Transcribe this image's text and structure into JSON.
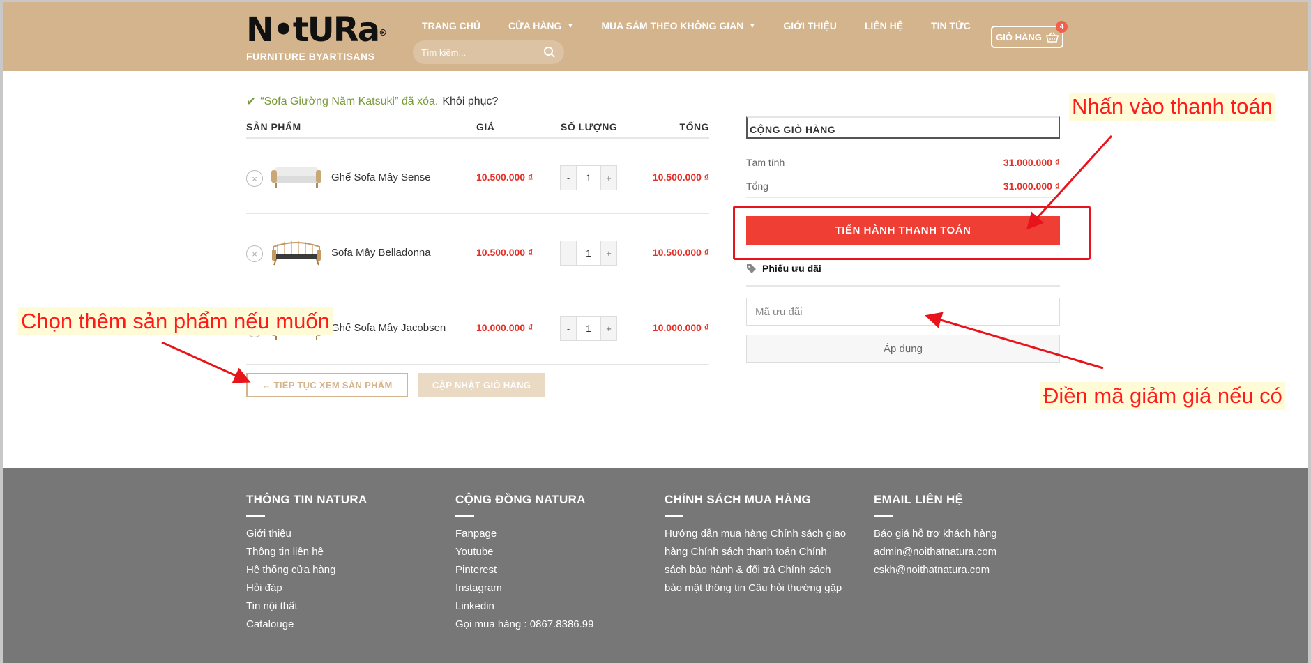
{
  "header": {
    "logo_wordmark": "N•tURa",
    "logo_reg": "®",
    "logo_tagline": "FURNITURE BYARTISANS",
    "nav": [
      {
        "label": "TRANG CHỦ",
        "dropdown": false
      },
      {
        "label": "CỬA HÀNG",
        "dropdown": true
      },
      {
        "label": "MUA SẮM THEO KHÔNG GIAN",
        "dropdown": true
      },
      {
        "label": "GIỚI THIỆU",
        "dropdown": false
      },
      {
        "label": "LIÊN HỆ",
        "dropdown": false
      },
      {
        "label": "TIN TỨC",
        "dropdown": false
      }
    ],
    "search_placeholder": "Tìm kiếm...",
    "cart_label": "GIỎ HÀNG",
    "cart_count": "4"
  },
  "notice": {
    "message": "“Sofa Giường Năm Katsuki” đã xóa.",
    "undo": "Khôi phục?"
  },
  "cart": {
    "headers": {
      "product": "SẢN PHẨM",
      "price": "GIÁ",
      "quantity": "SỐ LƯỢNG",
      "total": "TỔNG"
    },
    "items": [
      {
        "name": "Ghế Sofa Mây Sense",
        "price": "10.500.000 ₫",
        "qty": "1",
        "total": "10.500.000 ₫"
      },
      {
        "name": "Sofa Mây Belladonna",
        "price": "10.500.000 ₫",
        "qty": "1",
        "total": "10.500.000 ₫"
      },
      {
        "name": "Ghế Sofa Mây Jacobsen",
        "price": "10.000.000 ₫",
        "qty": "1",
        "total": "10.000.000 ₫"
      }
    ],
    "minus": "-",
    "plus": "+",
    "remove": "×",
    "continue_label": "← TIẾP TỤC XEM SẢN PHẨM",
    "update_label": "CẬP NHẬT GIỎ HÀNG"
  },
  "totals": {
    "title": "CỘNG GIỎ HÀNG",
    "subtotal_label": "Tạm tính",
    "subtotal_value": "31.000.000 ₫",
    "total_label": "Tổng",
    "total_value": "31.000.000 ₫",
    "checkout_label": "TIẾN HÀNH THANH TOÁN",
    "coupon_heading": "Phiếu ưu đãi",
    "coupon_placeholder": "Mã ưu đãi",
    "apply_label": "Áp dụng"
  },
  "footer": {
    "col1": {
      "title": "THÔNG TIN NATURA",
      "links": [
        "Giới thiệu",
        "Thông tin liên hệ",
        "Hệ thống cửa hàng",
        "Hỏi đáp",
        "Tin nội thất",
        "Catalouge"
      ]
    },
    "col2": {
      "title": "CỘNG ĐỒNG NATURA",
      "links": [
        "Fanpage",
        "Youtube",
        "Pinterest",
        "Instagram",
        "Linkedin",
        "Gọi mua hàng : 0867.8386.99"
      ]
    },
    "col3": {
      "title": "CHÍNH SÁCH MUA HÀNG",
      "text": "Hướng dẫn mua hàng Chính sách giao hàng Chính sách thanh toán Chính sách bảo hành & đổi trả Chính sách bảo mật thông tin Câu hỏi thường gặp"
    },
    "col4": {
      "title": "EMAIL LIÊN HỆ",
      "links": [
        "Báo giá hỗ trợ khách hàng",
        "admin@noithatnatura.com",
        "cskh@noithatnatura.com"
      ]
    }
  },
  "annotations": {
    "checkout_hint": "Nhấn vào thanh toán",
    "more_products_hint": "Chọn thêm sản phẩm nếu muốn",
    "coupon_hint": "Điền mã giảm giá nếu có"
  },
  "colors": {
    "header_bg": "#d4b48c",
    "price_red": "#e52f26",
    "checkout_red": "#ef3e33",
    "footer_bg": "#777777",
    "annotation_red": "#ff1a1a",
    "notice_green": "#7a9a3a"
  }
}
